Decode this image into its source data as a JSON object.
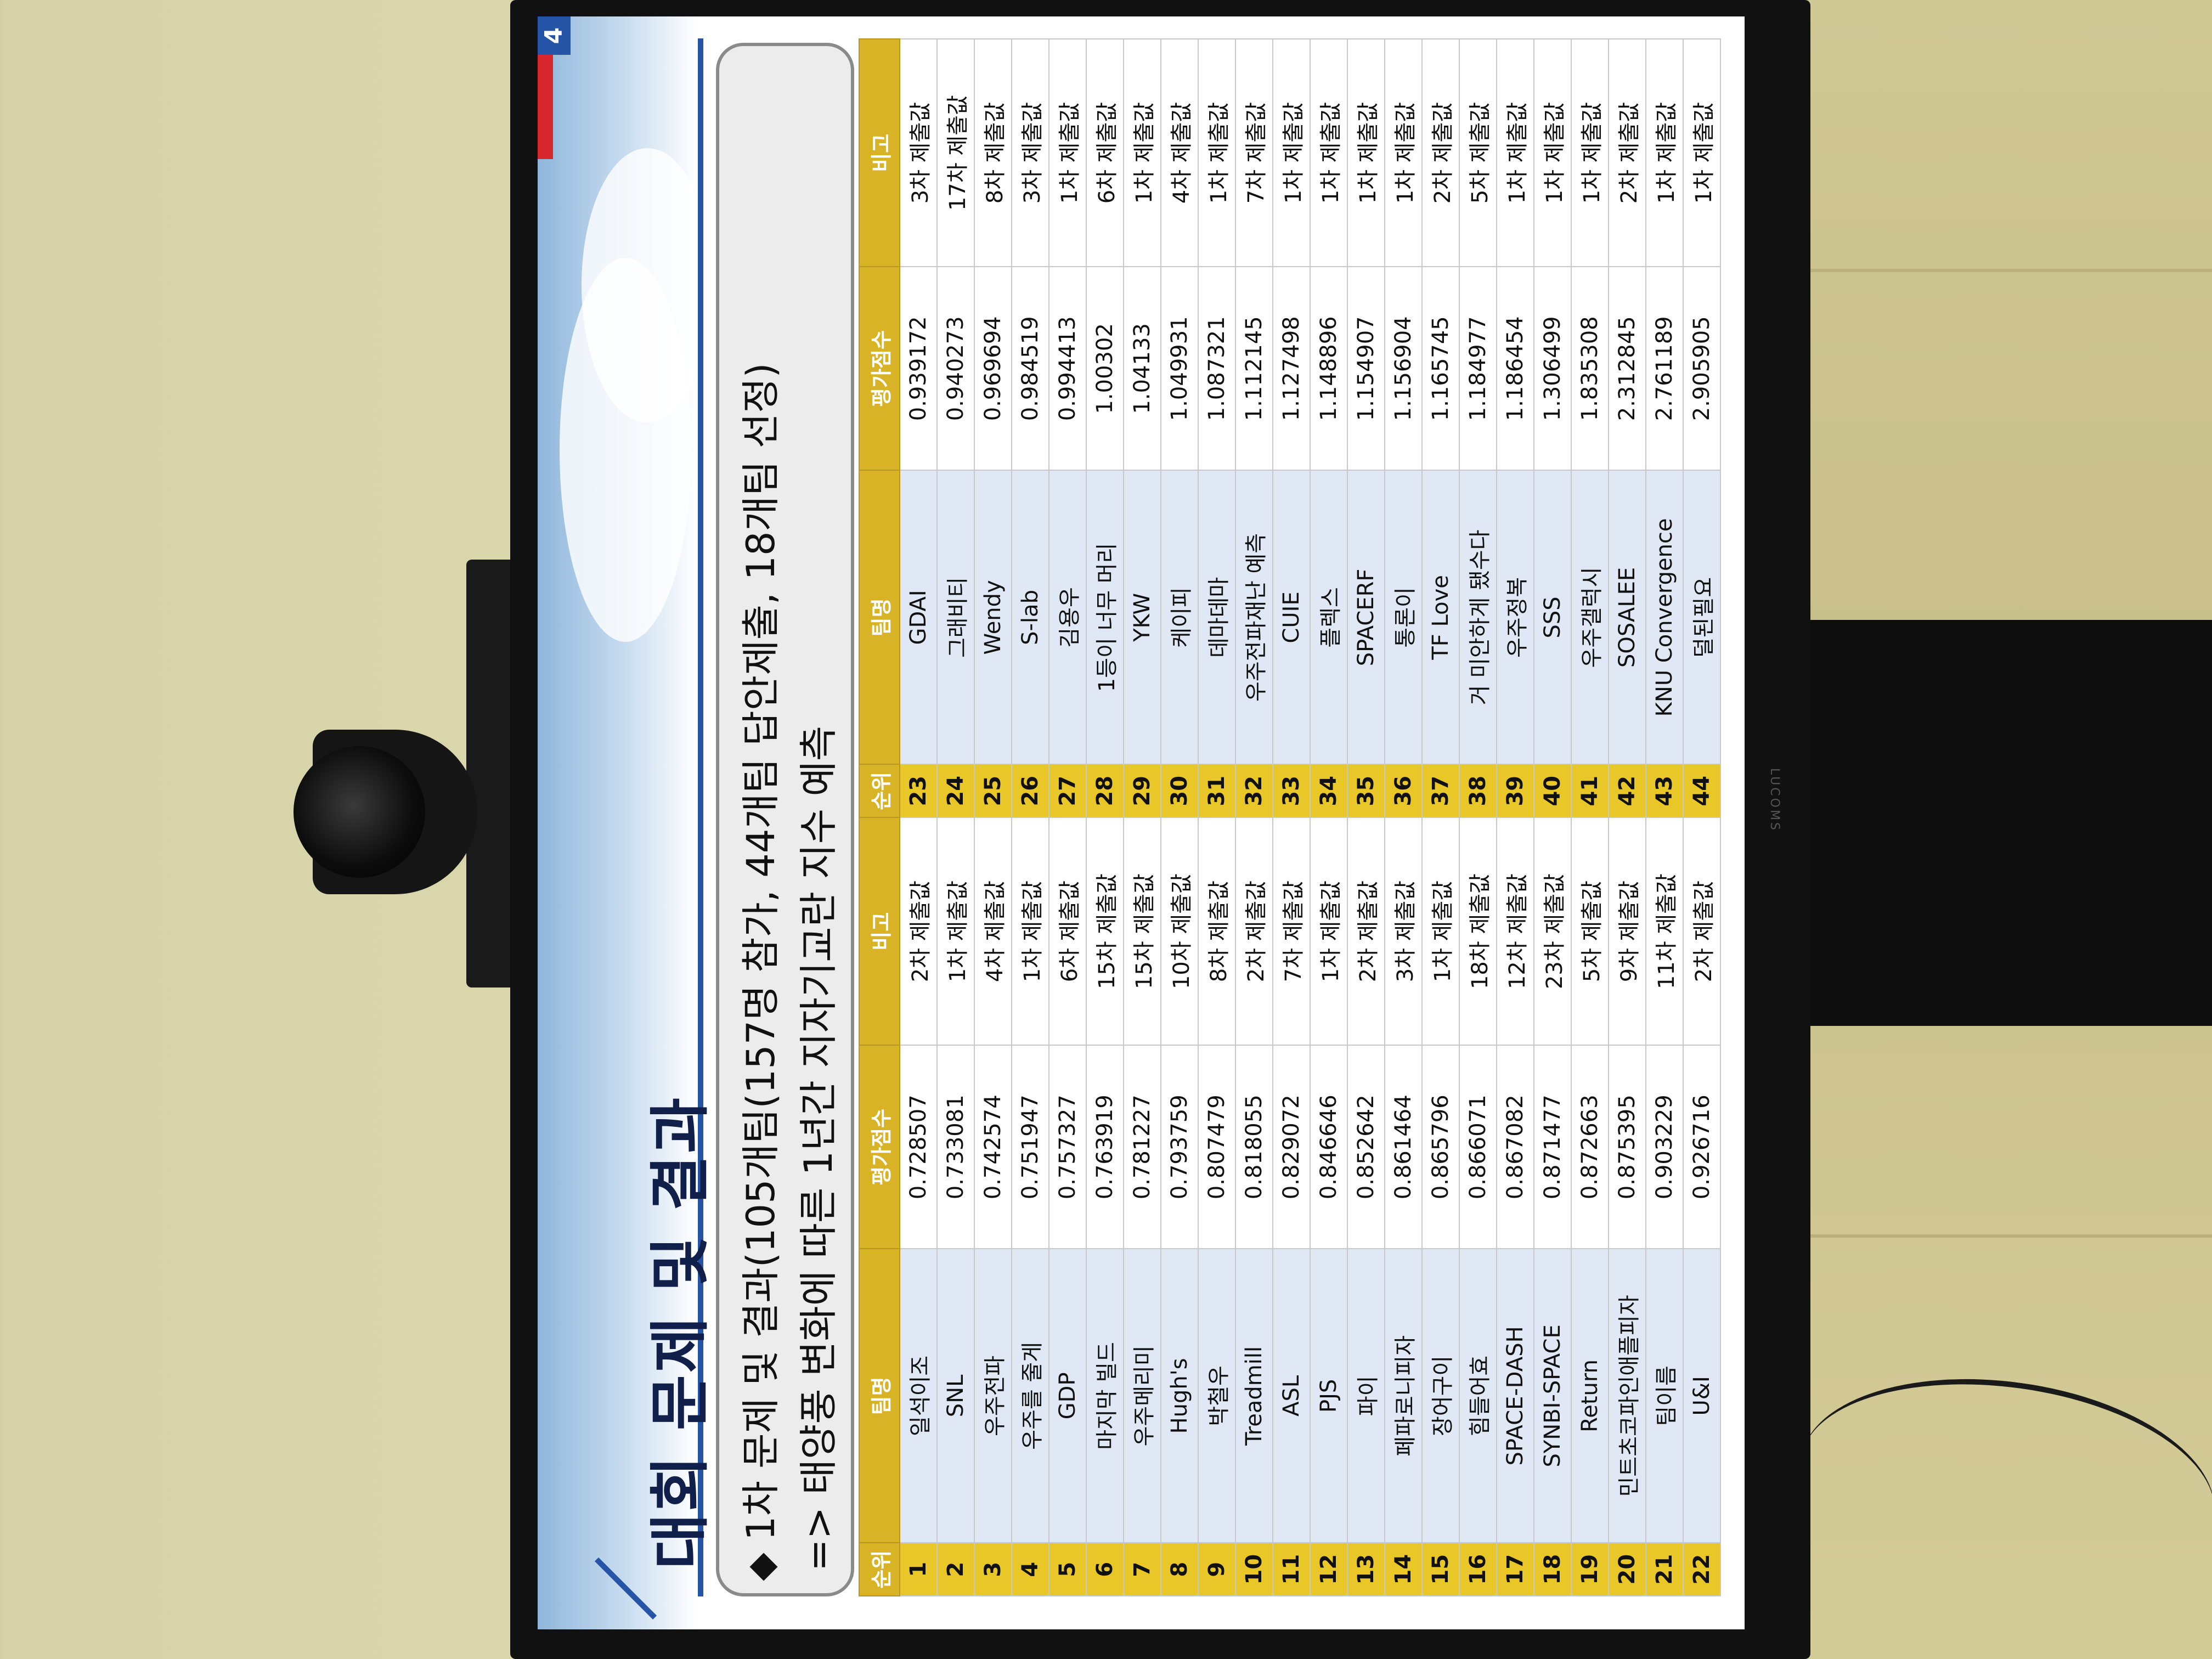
{
  "slide": {
    "title": "대회 문제 및 결과",
    "page_number": "4",
    "callout_line1": "1차 문제 및 결과(105개팀(157명 참가, 44개팀 답안제출, 18개팀 선정)",
    "callout_line2": "=> 태양풍 변화에 따른 1년간 지자기교란 지수 예측"
  },
  "tv": {
    "brand": "LUCOMS"
  },
  "table": {
    "headers": [
      "순위",
      "팀명",
      "평가점수",
      "비고",
      "순위",
      "팀명",
      "평가점수",
      "비고"
    ],
    "rows": [
      [
        "1",
        "일석이조",
        "0.728507",
        "2차 제출값",
        "23",
        "GDAI",
        "0.939172",
        "3차 제출값"
      ],
      [
        "2",
        "SNL",
        "0.733081",
        "1차 제출값",
        "24",
        "그래비티",
        "0.940273",
        "17차 제출값"
      ],
      [
        "3",
        "우주전파",
        "0.742574",
        "4차 제출값",
        "25",
        "Wendy",
        "0.969694",
        "8차 제출값"
      ],
      [
        "4",
        "우주를 줄게",
        "0.751947",
        "1차 제출값",
        "26",
        "S-lab",
        "0.984519",
        "3차 제출값"
      ],
      [
        "5",
        "GDP",
        "0.757327",
        "6차 제출값",
        "27",
        "김용우",
        "0.994413",
        "1차 제출값"
      ],
      [
        "6",
        "마지막 빌드",
        "0.763919",
        "15차 제출값",
        "28",
        "1등이 너무 머리",
        "1.00302",
        "6차 제출값"
      ],
      [
        "7",
        "우주메리미",
        "0.781227",
        "15차 제출값",
        "29",
        "YKW",
        "1.04133",
        "1차 제출값"
      ],
      [
        "8",
        "Hugh's",
        "0.793759",
        "10차 제출값",
        "30",
        "케이피",
        "1.049931",
        "4차 제출값"
      ],
      [
        "9",
        "박철우",
        "0.807479",
        "8차 제출값",
        "31",
        "데마데마",
        "1.087321",
        "1차 제출값"
      ],
      [
        "10",
        "Treadmill",
        "0.818055",
        "2차 제출값",
        "32",
        "우주전파재난 예측",
        "1.112145",
        "7차 제출값"
      ],
      [
        "11",
        "ASL",
        "0.829072",
        "7차 제출값",
        "33",
        "CUIE",
        "1.127498",
        "1차 제출값"
      ],
      [
        "12",
        "PJS",
        "0.846646",
        "1차 제출값",
        "34",
        "플렉스",
        "1.148896",
        "1차 제출값"
      ],
      [
        "13",
        "파이",
        "0.852642",
        "2차 제출값",
        "35",
        "SPACERF",
        "1.154907",
        "1차 제출값"
      ],
      [
        "14",
        "페파로니피자",
        "0.861464",
        "3차 제출값",
        "36",
        "통론이",
        "1.156904",
        "1차 제출값"
      ],
      [
        "15",
        "장어구이",
        "0.865796",
        "1차 제출값",
        "37",
        "TF Love",
        "1.165745",
        "2차 제출값"
      ],
      [
        "16",
        "힘들어효",
        "0.866071",
        "18차 제출값",
        "38",
        "거 미안하게 됐수다",
        "1.184977",
        "5차 제출값"
      ],
      [
        "17",
        "SPACE-DASH",
        "0.867082",
        "12차 제출값",
        "39",
        "우주정복",
        "1.186454",
        "1차 제출값"
      ],
      [
        "18",
        "SYNBI-SPACE",
        "0.871477",
        "23차 제출값",
        "40",
        "SSS",
        "1.306499",
        "1차 제출값"
      ],
      [
        "19",
        "Return",
        "0.872663",
        "5차 제출값",
        "41",
        "우주갤럭시",
        "1.835308",
        "1차 제출값"
      ],
      [
        "20",
        "민트초코파인애플피자",
        "0.875395",
        "9차 제출값",
        "42",
        "SOSALEE",
        "2.312845",
        "2차 제출값"
      ],
      [
        "21",
        "팀이름",
        "0.903229",
        "11차 제출값",
        "43",
        "KNU Convergence",
        "2.761189",
        "1차 제출값"
      ],
      [
        "22",
        "U&I",
        "0.926716",
        "2차 제출값",
        "44",
        "덜된필요",
        "2.905905",
        "1차 제출값"
      ]
    ]
  }
}
